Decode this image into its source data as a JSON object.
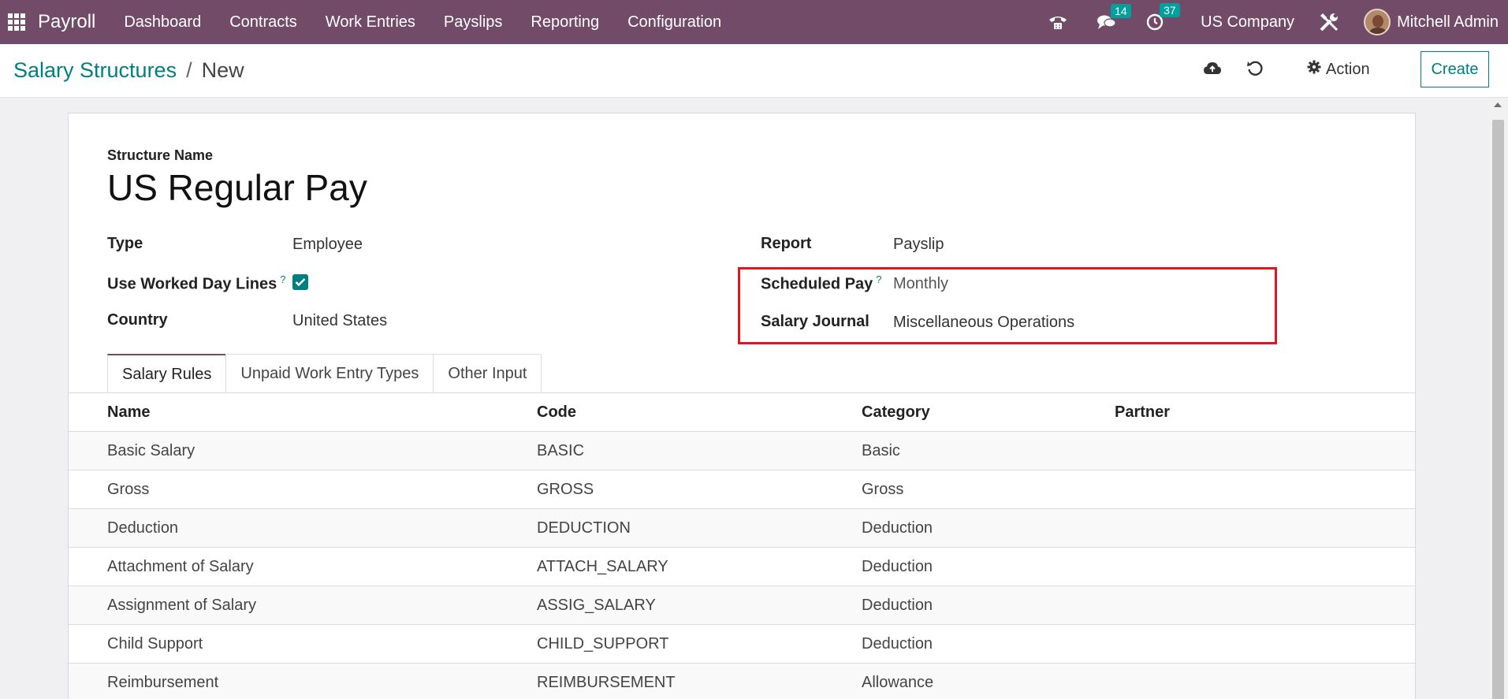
{
  "navbar": {
    "app_name": "Payroll",
    "menu": [
      "Dashboard",
      "Contracts",
      "Work Entries",
      "Payslips",
      "Reporting",
      "Configuration"
    ],
    "messages_count": "14",
    "activities_count": "37",
    "company": "US Company",
    "user": "Mitchell Admin"
  },
  "control": {
    "breadcrumb_parent": "Salary Structures",
    "breadcrumb_separator": "/",
    "breadcrumb_current": "New",
    "action_label": "Action",
    "create_label": "Create"
  },
  "form": {
    "structure_name_label": "Structure Name",
    "structure_name": "US Regular Pay",
    "type_label": "Type",
    "type_value": "Employee",
    "worked_day_lines_label": "Use Worked Day Lines",
    "worked_day_lines_checked": true,
    "country_label": "Country",
    "country_value": "United States",
    "report_label": "Report",
    "report_value": "Payslip",
    "scheduled_pay_label": "Scheduled Pay",
    "scheduled_pay_value": "Monthly",
    "salary_journal_label": "Salary Journal",
    "salary_journal_value": "Miscellaneous Operations",
    "help_mark": "?"
  },
  "tabs": [
    "Salary Rules",
    "Unpaid Work Entry Types",
    "Other Input"
  ],
  "table": {
    "headers": [
      "Name",
      "Code",
      "Category",
      "Partner"
    ],
    "rows": [
      [
        "Basic Salary",
        "BASIC",
        "Basic",
        ""
      ],
      [
        "Gross",
        "GROSS",
        "Gross",
        ""
      ],
      [
        "Deduction",
        "DEDUCTION",
        "Deduction",
        ""
      ],
      [
        "Attachment of Salary",
        "ATTACH_SALARY",
        "Deduction",
        ""
      ],
      [
        "Assignment of Salary",
        "ASSIG_SALARY",
        "Deduction",
        ""
      ],
      [
        "Child Support",
        "CHILD_SUPPORT",
        "Deduction",
        ""
      ],
      [
        "Reimbursement",
        "REIMBURSEMENT",
        "Allowance",
        ""
      ]
    ]
  },
  "colors": {
    "navbar": "#714b67",
    "accent": "#017e84",
    "badge": "#00a09d",
    "highlight": "#e0161e"
  },
  "icons": [
    "apps-grid-icon",
    "phone-icon",
    "chat-icon",
    "clock-icon",
    "tools-icon",
    "cloud-upload-icon",
    "undo-icon",
    "gear-icon"
  ]
}
